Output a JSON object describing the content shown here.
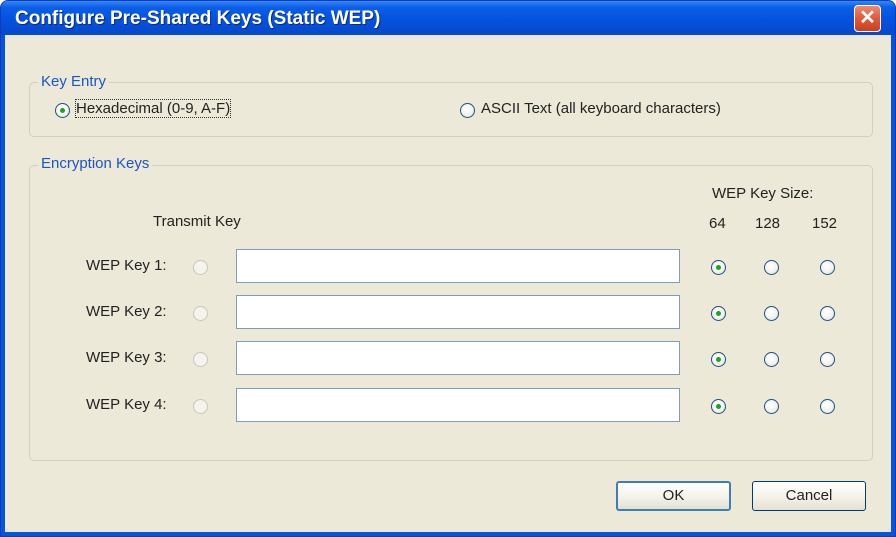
{
  "window": {
    "title": "Configure Pre-Shared Keys (Static WEP)",
    "close_glyph": "✕"
  },
  "key_entry": {
    "legend": "Key Entry",
    "options": [
      {
        "label": "Hexadecimal (0-9, A-F)",
        "selected": true
      },
      {
        "label": "ASCII Text (all keyboard characters)",
        "selected": false
      }
    ]
  },
  "encryption": {
    "legend": "Encryption Keys",
    "transmit_header": "Transmit Key",
    "size_header": "WEP Key Size:",
    "sizes": [
      "64",
      "128",
      "152"
    ],
    "keys": [
      {
        "label": "WEP Key 1:",
        "value": "",
        "size_selected": "64"
      },
      {
        "label": "WEP Key 2:",
        "value": "",
        "size_selected": "64"
      },
      {
        "label": "WEP Key 3:",
        "value": "",
        "size_selected": "64"
      },
      {
        "label": "WEP Key 4:",
        "value": "",
        "size_selected": "64"
      }
    ]
  },
  "buttons": {
    "ok": "OK",
    "cancel": "Cancel"
  },
  "colors": {
    "title_bar": "#0a5fe8",
    "dialog_bg": "#ece9d8",
    "legend_text": "#1a55c8",
    "radio_dot": "#21a121",
    "close_button": "#e1583a"
  }
}
